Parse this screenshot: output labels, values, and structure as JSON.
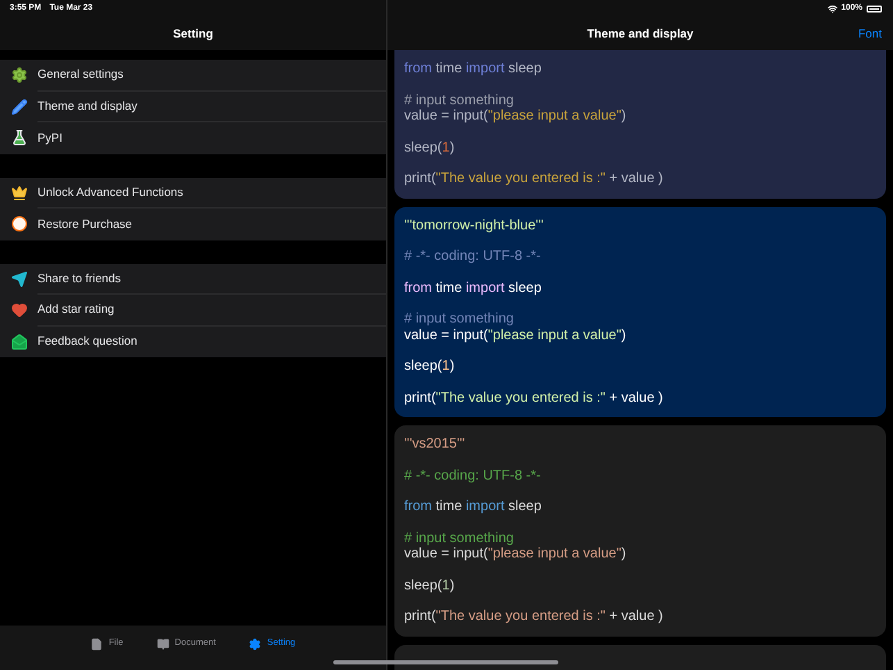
{
  "status_bar": {
    "time": "3:55 PM",
    "date": "Tue Mar 23",
    "battery": "100%"
  },
  "sidebar": {
    "title": "Setting",
    "groups": [
      [
        {
          "label": "General settings"
        },
        {
          "label": "Theme and display"
        },
        {
          "label": "PyPI"
        }
      ],
      [
        {
          "label": "Unlock Advanced Functions"
        },
        {
          "label": "Restore Purchase"
        }
      ],
      [
        {
          "label": "Share to friends"
        },
        {
          "label": "Add star rating"
        },
        {
          "label": "Feedback question"
        }
      ]
    ]
  },
  "tabs": [
    {
      "label": "File",
      "selected": false
    },
    {
      "label": "Document",
      "selected": false
    },
    {
      "label": "Setting",
      "selected": true
    }
  ],
  "detail": {
    "title": "Theme and display",
    "action": "Font",
    "cards": [
      {
        "kind": "indigo",
        "blocks": [
          [
            [
              {
                "kind": "kw",
                "text": "from"
              },
              {
                "kind": "plain",
                "text": " time "
              },
              {
                "kind": "kw",
                "text": "import"
              },
              {
                "kind": "plain",
                "text": " sleep"
              }
            ]
          ],
          [
            [
              {
                "kind": "cmt",
                "text": "# input something"
              }
            ],
            [
              {
                "kind": "plain",
                "text": "value = input("
              },
              {
                "kind": "str",
                "text": "\"please input a value\""
              },
              {
                "kind": "plain",
                "text": ")"
              }
            ]
          ],
          [
            [
              {
                "kind": "plain",
                "text": "sleep("
              },
              {
                "kind": "num",
                "text": "1"
              },
              {
                "kind": "plain",
                "text": ")"
              }
            ]
          ],
          [
            [
              {
                "kind": "plain",
                "text": "print("
              },
              {
                "kind": "str",
                "text": "\"The value you entered is :\""
              },
              {
                "kind": "plain",
                "text": " + value )"
              }
            ]
          ]
        ]
      },
      {
        "kind": "navy",
        "blocks": [
          [
            [
              {
                "kind": "doc",
                "text": "'''tomorrow-night-blue'''"
              }
            ]
          ],
          [
            [
              {
                "kind": "cmt",
                "text": "# -*- coding: UTF-8 -*-"
              }
            ]
          ],
          [
            [
              {
                "kind": "kw",
                "text": "from"
              },
              {
                "kind": "plain",
                "text": " time "
              },
              {
                "kind": "kw",
                "text": "import"
              },
              {
                "kind": "plain",
                "text": " sleep"
              }
            ]
          ],
          [
            [
              {
                "kind": "cmt",
                "text": "# input something"
              }
            ],
            [
              {
                "kind": "plain",
                "text": "value = input("
              },
              {
                "kind": "str",
                "text": "\"please input a value\""
              },
              {
                "kind": "plain",
                "text": ")"
              }
            ]
          ],
          [
            [
              {
                "kind": "plain",
                "text": "sleep("
              },
              {
                "kind": "num",
                "text": "1"
              },
              {
                "kind": "plain",
                "text": ")"
              }
            ]
          ],
          [
            [
              {
                "kind": "plain",
                "text": "print("
              },
              {
                "kind": "str",
                "text": "\"The value you entered is :\""
              },
              {
                "kind": "plain",
                "text": " + value )"
              }
            ]
          ]
        ]
      },
      {
        "kind": "charcoal",
        "blocks": [
          [
            [
              {
                "kind": "doc",
                "text": "'''vs2015'''"
              }
            ]
          ],
          [
            [
              {
                "kind": "cmt",
                "text": "# -*- coding: UTF-8 -*-"
              }
            ]
          ],
          [
            [
              {
                "kind": "kw",
                "text": "from"
              },
              {
                "kind": "plain",
                "text": " time "
              },
              {
                "kind": "kw",
                "text": "import"
              },
              {
                "kind": "plain",
                "text": " sleep"
              }
            ]
          ],
          [
            [
              {
                "kind": "cmt",
                "text": "# input something"
              }
            ],
            [
              {
                "kind": "plain",
                "text": "value = input("
              },
              {
                "kind": "str",
                "text": "\"please input a value\""
              },
              {
                "kind": "plain",
                "text": ")"
              }
            ]
          ],
          [
            [
              {
                "kind": "plain",
                "text": "sleep("
              },
              {
                "kind": "num",
                "text": "1"
              },
              {
                "kind": "plain",
                "text": ")"
              }
            ]
          ],
          [
            [
              {
                "kind": "plain",
                "text": "print("
              },
              {
                "kind": "str",
                "text": "\"The value you entered is :\""
              },
              {
                "kind": "plain",
                "text": " + value )"
              }
            ]
          ]
        ]
      }
    ]
  }
}
